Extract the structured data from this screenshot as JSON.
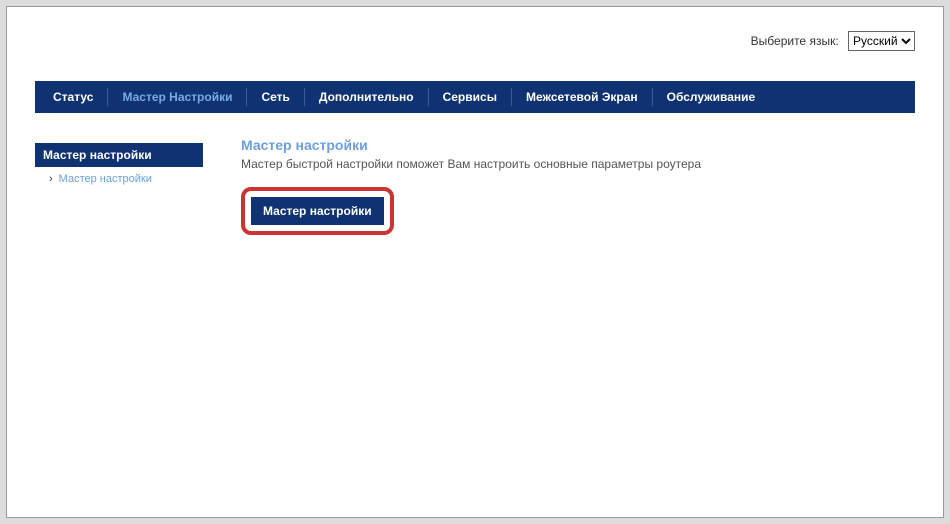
{
  "lang": {
    "label": "Выберите язык:",
    "selected": "Русский"
  },
  "nav": {
    "items": [
      "Статус",
      "Мастер Настройки",
      "Сеть",
      "Дополнительно",
      "Сервисы",
      "Межсетевой Экран",
      "Обслуживание"
    ],
    "active_index": 1
  },
  "sidebar": {
    "title": "Мастер настройки",
    "items": [
      "Мастер настройки"
    ]
  },
  "content": {
    "title": "Мастер настройки",
    "desc": "Мастер быстрой настройки поможет Вам настроить основные параметры роутера",
    "button": "Мастер настройки"
  }
}
